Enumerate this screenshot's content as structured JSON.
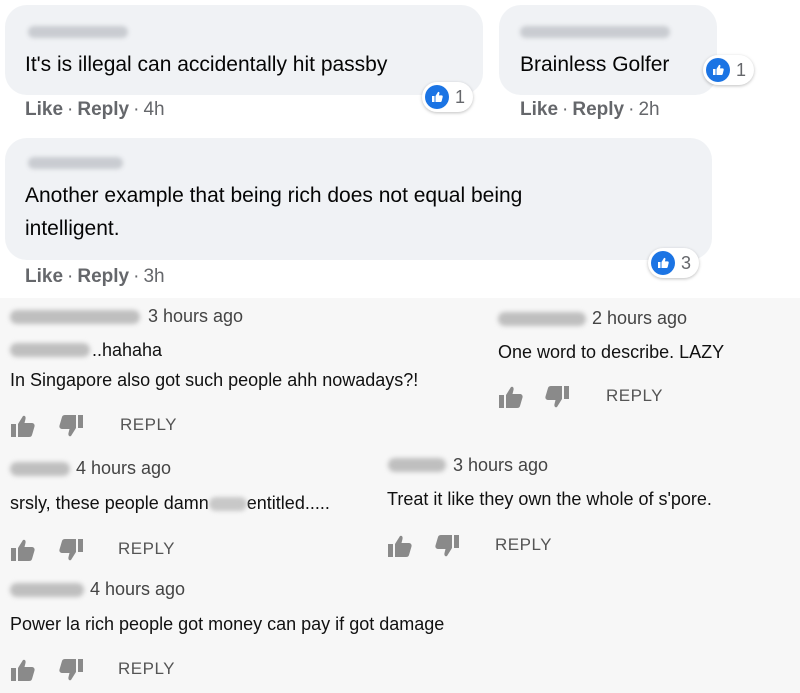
{
  "facebook": {
    "like_label": "Like",
    "reply_label": "Reply",
    "comments": [
      {
        "text": "It's is illegal can accidentally hit passby",
        "time": "4h",
        "reactions": "1"
      },
      {
        "text": "Brainless Golfer",
        "time": "2h",
        "reactions": "1"
      },
      {
        "text_line1": "Another example that being rich does not equal being",
        "text_line2": "intelligent.",
        "time": "3h",
        "reactions": "3"
      }
    ]
  },
  "youtube": {
    "reply_label": "REPLY",
    "comments": [
      {
        "time": "3 hours ago",
        "text_line1": "..hahaha",
        "text_line2": "In Singapore also got such people ahh nowadays?!"
      },
      {
        "time": "2 hours ago",
        "text": "One word to describe. LAZY"
      },
      {
        "time": "4 hours ago",
        "text_pre": "srsly, these people damn",
        "text_post": "entitled....."
      },
      {
        "time": "3 hours ago",
        "text": "Treat it like they own the whole of s'pore."
      },
      {
        "time": "4 hours ago",
        "text": "Power la rich people got money can pay if got damage"
      }
    ]
  },
  "colors": {
    "fb_blue": "#1b74e4",
    "bubble": "#f0f2f5",
    "yt_bg": "#f7f7f7"
  }
}
